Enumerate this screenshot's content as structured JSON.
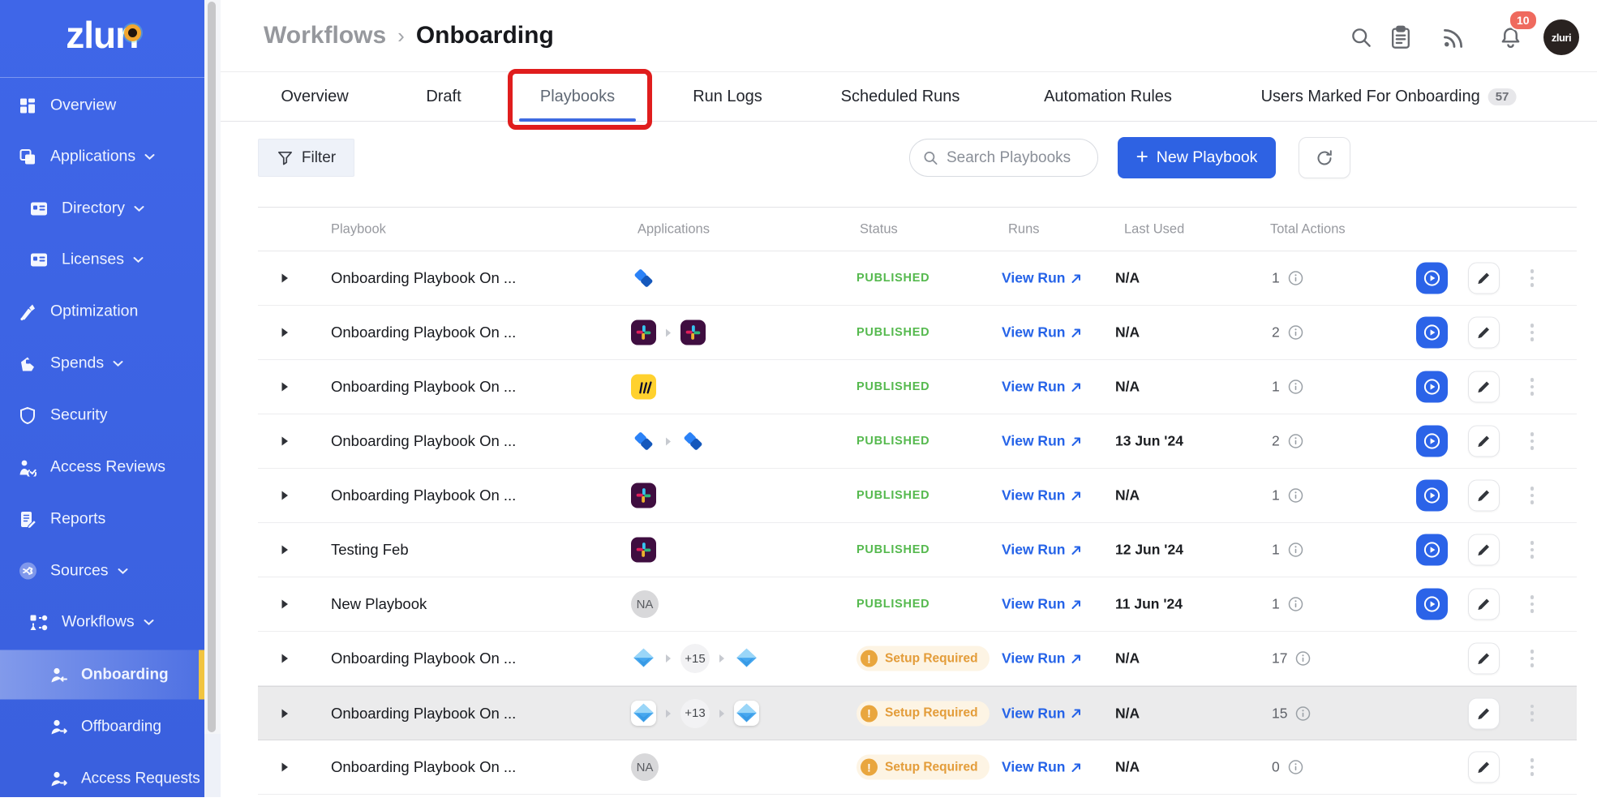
{
  "app": {
    "logo_text": "zluri"
  },
  "colors": {
    "sidebar_blue": "#3D63E4",
    "accent_blue": "#2E62E3",
    "link_blue": "#2563E8",
    "published_green": "#55B94E",
    "warning_orange": "#E9A63E",
    "annotation_red": "#E01D1D",
    "active_item_bar_yellow": "#F1C440"
  },
  "sidebar": {
    "items": [
      {
        "label": "Overview",
        "icon": "overview-grid-icon",
        "chevron": false,
        "indent": 0,
        "active": false
      },
      {
        "label": "Applications",
        "icon": "applications-icon",
        "chevron": true,
        "indent": 0,
        "active": false
      },
      {
        "label": "Directory",
        "icon": "directory-card-icon",
        "chevron": true,
        "indent": 1,
        "active": false
      },
      {
        "label": "Licenses",
        "icon": "licenses-card-icon",
        "chevron": true,
        "indent": 1,
        "active": false
      },
      {
        "label": "Optimization",
        "icon": "optimization-rocket-icon",
        "chevron": false,
        "indent": 0,
        "active": false
      },
      {
        "label": "Spends",
        "icon": "spends-icon",
        "chevron": true,
        "indent": 0,
        "active": false
      },
      {
        "label": "Security",
        "icon": "security-shield-icon",
        "chevron": false,
        "indent": 0,
        "active": false
      },
      {
        "label": "Access Reviews",
        "icon": "access-reviews-icon",
        "chevron": false,
        "indent": 0,
        "active": false
      },
      {
        "label": "Reports",
        "icon": "reports-icon",
        "chevron": false,
        "indent": 0,
        "active": false
      },
      {
        "label": "Sources",
        "icon": "sources-icon",
        "chevron": true,
        "indent": 0,
        "active": false
      },
      {
        "label": "Workflows",
        "icon": "workflows-icon",
        "chevron": true,
        "indent": 1,
        "active": false
      },
      {
        "label": "Onboarding",
        "icon": "onboarding-person-icon",
        "chevron": false,
        "indent": 2,
        "active": true
      },
      {
        "label": "Offboarding",
        "icon": "offboarding-person-icon",
        "chevron": false,
        "indent": 2,
        "active": false
      },
      {
        "label": "Access Requests",
        "icon": "access-requests-person-icon",
        "chevron": false,
        "indent": 2,
        "active": false
      }
    ]
  },
  "header": {
    "breadcrumb_parent": "Workflows",
    "breadcrumb_separator": "›",
    "breadcrumb_current": "Onboarding",
    "notification_count": "10",
    "avatar_text": "zluri"
  },
  "tabs": {
    "items": [
      {
        "label": "Overview",
        "active": false
      },
      {
        "label": "Draft",
        "active": false
      },
      {
        "label": "Playbooks",
        "active": true,
        "annotated": true
      },
      {
        "label": "Run Logs",
        "active": false
      },
      {
        "label": "Scheduled Runs",
        "active": false
      },
      {
        "label": "Automation Rules",
        "active": false
      },
      {
        "label": "Users Marked For Onboarding",
        "active": false,
        "badge": "57"
      }
    ]
  },
  "toolbar": {
    "filter_label": "Filter",
    "search_placeholder": "Search Playbooks",
    "new_playbook_plus": "+",
    "new_playbook_label": "New Playbook"
  },
  "table": {
    "columns": [
      "Playbook",
      "Applications",
      "Status",
      "Runs",
      "Last Used",
      "Total Actions"
    ],
    "view_run_label": "View Run",
    "status_published": "PUBLISHED",
    "status_setup_required": "Setup Required",
    "rows": [
      {
        "name": "Onboarding Playbook On ...",
        "apps": [
          "jira"
        ],
        "status": "published",
        "last_used": "N/A",
        "total_actions": "1",
        "has_play": true,
        "highlighted": false
      },
      {
        "name": "Onboarding Playbook On ...",
        "apps": [
          "slack",
          "slack"
        ],
        "status": "published",
        "last_used": "N/A",
        "total_actions": "2",
        "has_play": true,
        "highlighted": false
      },
      {
        "name": "Onboarding Playbook On ...",
        "apps": [
          "miro"
        ],
        "status": "published",
        "last_used": "N/A",
        "total_actions": "1",
        "has_play": true,
        "highlighted": false
      },
      {
        "name": "Onboarding Playbook On ...",
        "apps": [
          "jira",
          "jira"
        ],
        "status": "published",
        "last_used": "13 Jun '24",
        "total_actions": "2",
        "has_play": true,
        "highlighted": false
      },
      {
        "name": "Onboarding Playbook On ...",
        "apps": [
          "slack"
        ],
        "status": "published",
        "last_used": "N/A",
        "total_actions": "1",
        "has_play": true,
        "highlighted": false
      },
      {
        "name": "Testing Feb",
        "apps": [
          "slack"
        ],
        "status": "published",
        "last_used": "12 Jun '24",
        "total_actions": "1",
        "has_play": true,
        "highlighted": false
      },
      {
        "name": "New Playbook",
        "apps": [
          "na"
        ],
        "status": "published",
        "last_used": "11 Jun '24",
        "total_actions": "1",
        "has_play": true,
        "highlighted": false
      },
      {
        "name": "Onboarding Playbook On ...",
        "apps": [
          "diamond",
          "+15",
          "diamond"
        ],
        "status": "setup_required",
        "last_used": "N/A",
        "total_actions": "17",
        "has_play": false,
        "highlighted": false
      },
      {
        "name": "Onboarding Playbook On ...",
        "apps": [
          "diamond",
          "+13",
          "diamond"
        ],
        "status": "setup_required",
        "last_used": "N/A",
        "total_actions": "15",
        "has_play": false,
        "highlighted": true
      },
      {
        "name": "Onboarding Playbook On ...",
        "apps": [
          "na"
        ],
        "status": "setup_required",
        "last_used": "N/A",
        "total_actions": "0",
        "has_play": false,
        "highlighted": false
      }
    ]
  }
}
